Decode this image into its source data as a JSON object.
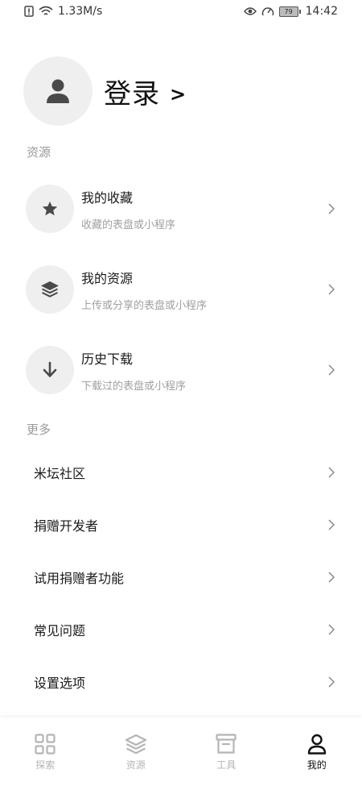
{
  "status_bar": {
    "network_speed": "1.33M/s",
    "battery": "79",
    "time": "14:42"
  },
  "profile": {
    "login_label": "登录",
    "login_arrow": ">"
  },
  "sections": {
    "resources_title": "资源",
    "more_title": "更多"
  },
  "resources": [
    {
      "title": "我的收藏",
      "subtitle": "收藏的表盘或小程序",
      "icon": "star-icon"
    },
    {
      "title": "我的资源",
      "subtitle": "上传或分享的表盘或小程序",
      "icon": "layers-icon"
    },
    {
      "title": "历史下载",
      "subtitle": "下载过的表盘或小程序",
      "icon": "download-arrow-icon"
    }
  ],
  "more": [
    {
      "label": "米坛社区"
    },
    {
      "label": "捐赠开发者"
    },
    {
      "label": "试用捐赠者功能"
    },
    {
      "label": "常见问题"
    },
    {
      "label": "设置选项"
    }
  ],
  "bottom_nav": [
    {
      "label": "探索",
      "icon": "grid-icon"
    },
    {
      "label": "资源",
      "icon": "layers-icon"
    },
    {
      "label": "工具",
      "icon": "box-icon"
    },
    {
      "label": "我的",
      "icon": "person-icon",
      "active": true
    }
  ],
  "colors": {
    "icon_dark": "#4a4a4a",
    "nav_inactive": "#b5b5b5",
    "nav_active": "#111111",
    "circle_bg": "#efefef"
  }
}
